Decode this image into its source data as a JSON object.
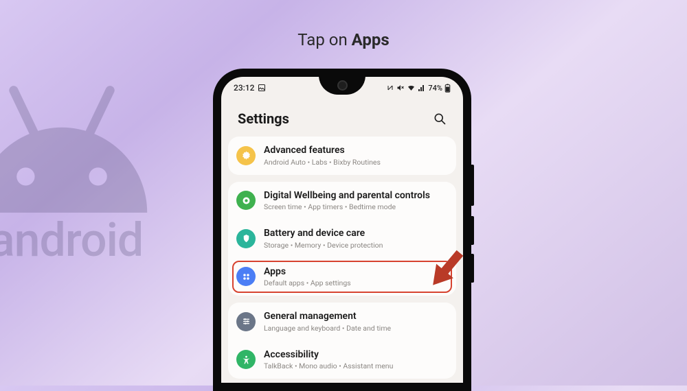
{
  "heading": {
    "prefix": "Tap on ",
    "bold": "Apps"
  },
  "status_bar": {
    "time": "23:12",
    "battery": "74%"
  },
  "header": {
    "title": "Settings"
  },
  "groups": [
    {
      "items": [
        {
          "title": "Advanced features",
          "sub": "Android Auto  •  Labs  •  Bixby Routines",
          "icon_color": "#f5c34a",
          "icon": "gear"
        }
      ]
    },
    {
      "items": [
        {
          "title": "Digital Wellbeing and parental controls",
          "sub": "Screen time  •  App timers  •  Bedtime mode",
          "icon_color": "#3fb14f",
          "icon": "wellbeing"
        },
        {
          "title": "Battery and device care",
          "sub": "Storage  •  Memory  •  Device protection",
          "icon_color": "#2bb59b",
          "icon": "care"
        },
        {
          "title": "Apps",
          "sub": "Default apps  •  App settings",
          "icon_color": "#4b7ef5",
          "icon": "apps",
          "highlighted": true
        }
      ]
    },
    {
      "items": [
        {
          "title": "General management",
          "sub": "Language and keyboard  •  Date and time",
          "icon_color": "#6b7688",
          "icon": "sliders"
        },
        {
          "title": "Accessibility",
          "sub": "TalkBack  •  Mono audio  •  Assistant menu",
          "icon_color": "#30b566",
          "icon": "accessibility"
        }
      ]
    }
  ]
}
